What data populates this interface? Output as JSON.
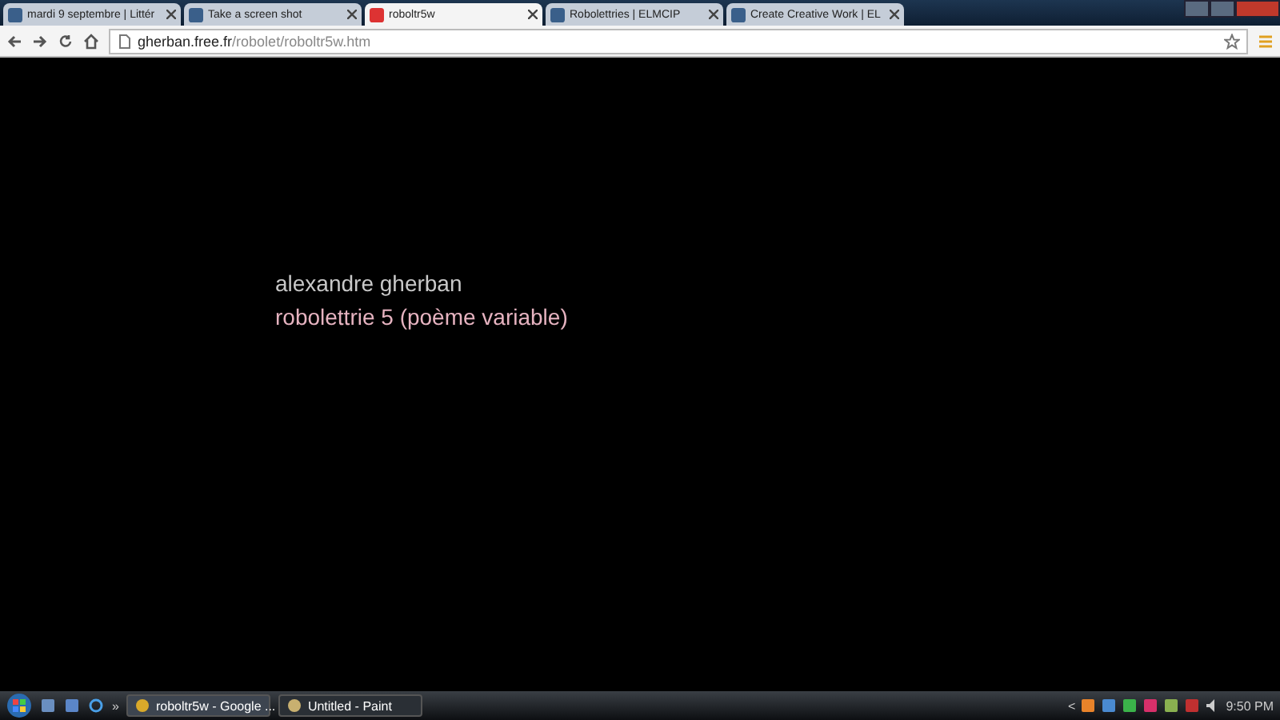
{
  "tabs": [
    {
      "label": "mardi 9 septembre | Littér",
      "selected": false
    },
    {
      "label": "Take a screen shot",
      "selected": false
    },
    {
      "label": "roboltr5w",
      "selected": true
    },
    {
      "label": "Robolettries | ELMCIP",
      "selected": false
    },
    {
      "label": "Create Creative Work | EL",
      "selected": false
    }
  ],
  "address_bar": {
    "host": "gherban.free.fr",
    "path": "/robolet/roboltr5w.htm"
  },
  "page": {
    "author": "alexandre gherban",
    "title": "robolettrie 5 (poème variable)"
  },
  "taskbar": {
    "overflow": "»",
    "tasks": [
      {
        "label": "roboltr5w - Google ...",
        "selected": true
      },
      {
        "label": "Untitled - Paint",
        "selected": false
      }
    ],
    "tray_expand": "<",
    "clock": "9:50 PM"
  }
}
